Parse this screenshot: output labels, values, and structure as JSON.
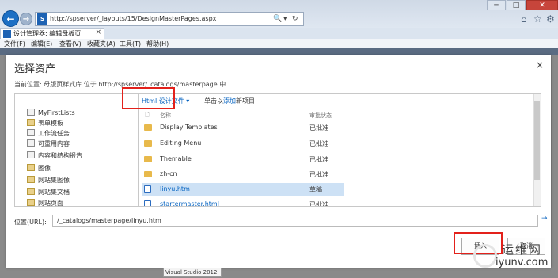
{
  "browser": {
    "url": "http://spserver/_layouts/15/DesignMasterPages.aspx",
    "tab_title": "设计管理器: 编辑母板页",
    "tab_close": "×",
    "back": "←",
    "forward": "→",
    "addr_tools": [
      "🔍",
      "▾",
      "↻"
    ],
    "win_min": "─",
    "win_max": "□",
    "win_close": "✕",
    "menu": [
      "文件(F)",
      "编辑(E)",
      "查看(V)",
      "收藏夹(A)",
      "工具(T)",
      "帮助(H)"
    ]
  },
  "dialog": {
    "title": "选择资产",
    "close": "×",
    "location": "当前位置: 母版页样式库 位于 http://spserver/_catalogs/masterpage 中",
    "tree": [
      {
        "label": "MyFirstLists",
        "type": "list"
      },
      {
        "label": "表单模板",
        "type": "lib"
      },
      {
        "label": "工作流任务",
        "type": "list"
      },
      {
        "label": "可重用内容",
        "type": "list"
      },
      {
        "label": "内容和结构报告",
        "type": "list"
      },
      {
        "label": "图像",
        "type": "lib"
      },
      {
        "label": "网站集图像",
        "type": "lib"
      },
      {
        "label": "网站集文档",
        "type": "lib"
      },
      {
        "label": "网站页面",
        "type": "lib"
      }
    ],
    "toolbar": {
      "dropdown": "Html 设计文件",
      "upload_prefix": "单击以",
      "upload_link": "添加",
      "upload_suffix": "新项目"
    },
    "columns": {
      "name": "名称",
      "status": "审批状态"
    },
    "files": [
      {
        "name": "Display Templates",
        "status": "已批准",
        "type": "folder"
      },
      {
        "name": "Editing Menu",
        "status": "已批准",
        "type": "folder"
      },
      {
        "name": "Themable",
        "status": "已批准",
        "type": "folder"
      },
      {
        "name": "zh-cn",
        "status": "已批准",
        "type": "folder"
      },
      {
        "name": "linyu.htm",
        "status": "草稿",
        "type": "doc",
        "selected": true
      },
      {
        "name": "startermaster.html",
        "status": "已批准",
        "type": "doc"
      }
    ],
    "url_label": "位置(URL):",
    "url_value": "/_catalogs/masterpage/linyu.htm",
    "url_go": "→",
    "insert_label": "插入",
    "cancel_label": "取消"
  },
  "taskbar": {
    "label": "Visual Studio 2012"
  },
  "watermark": {
    "cn": "运维网",
    "en": "iyunv.com"
  }
}
